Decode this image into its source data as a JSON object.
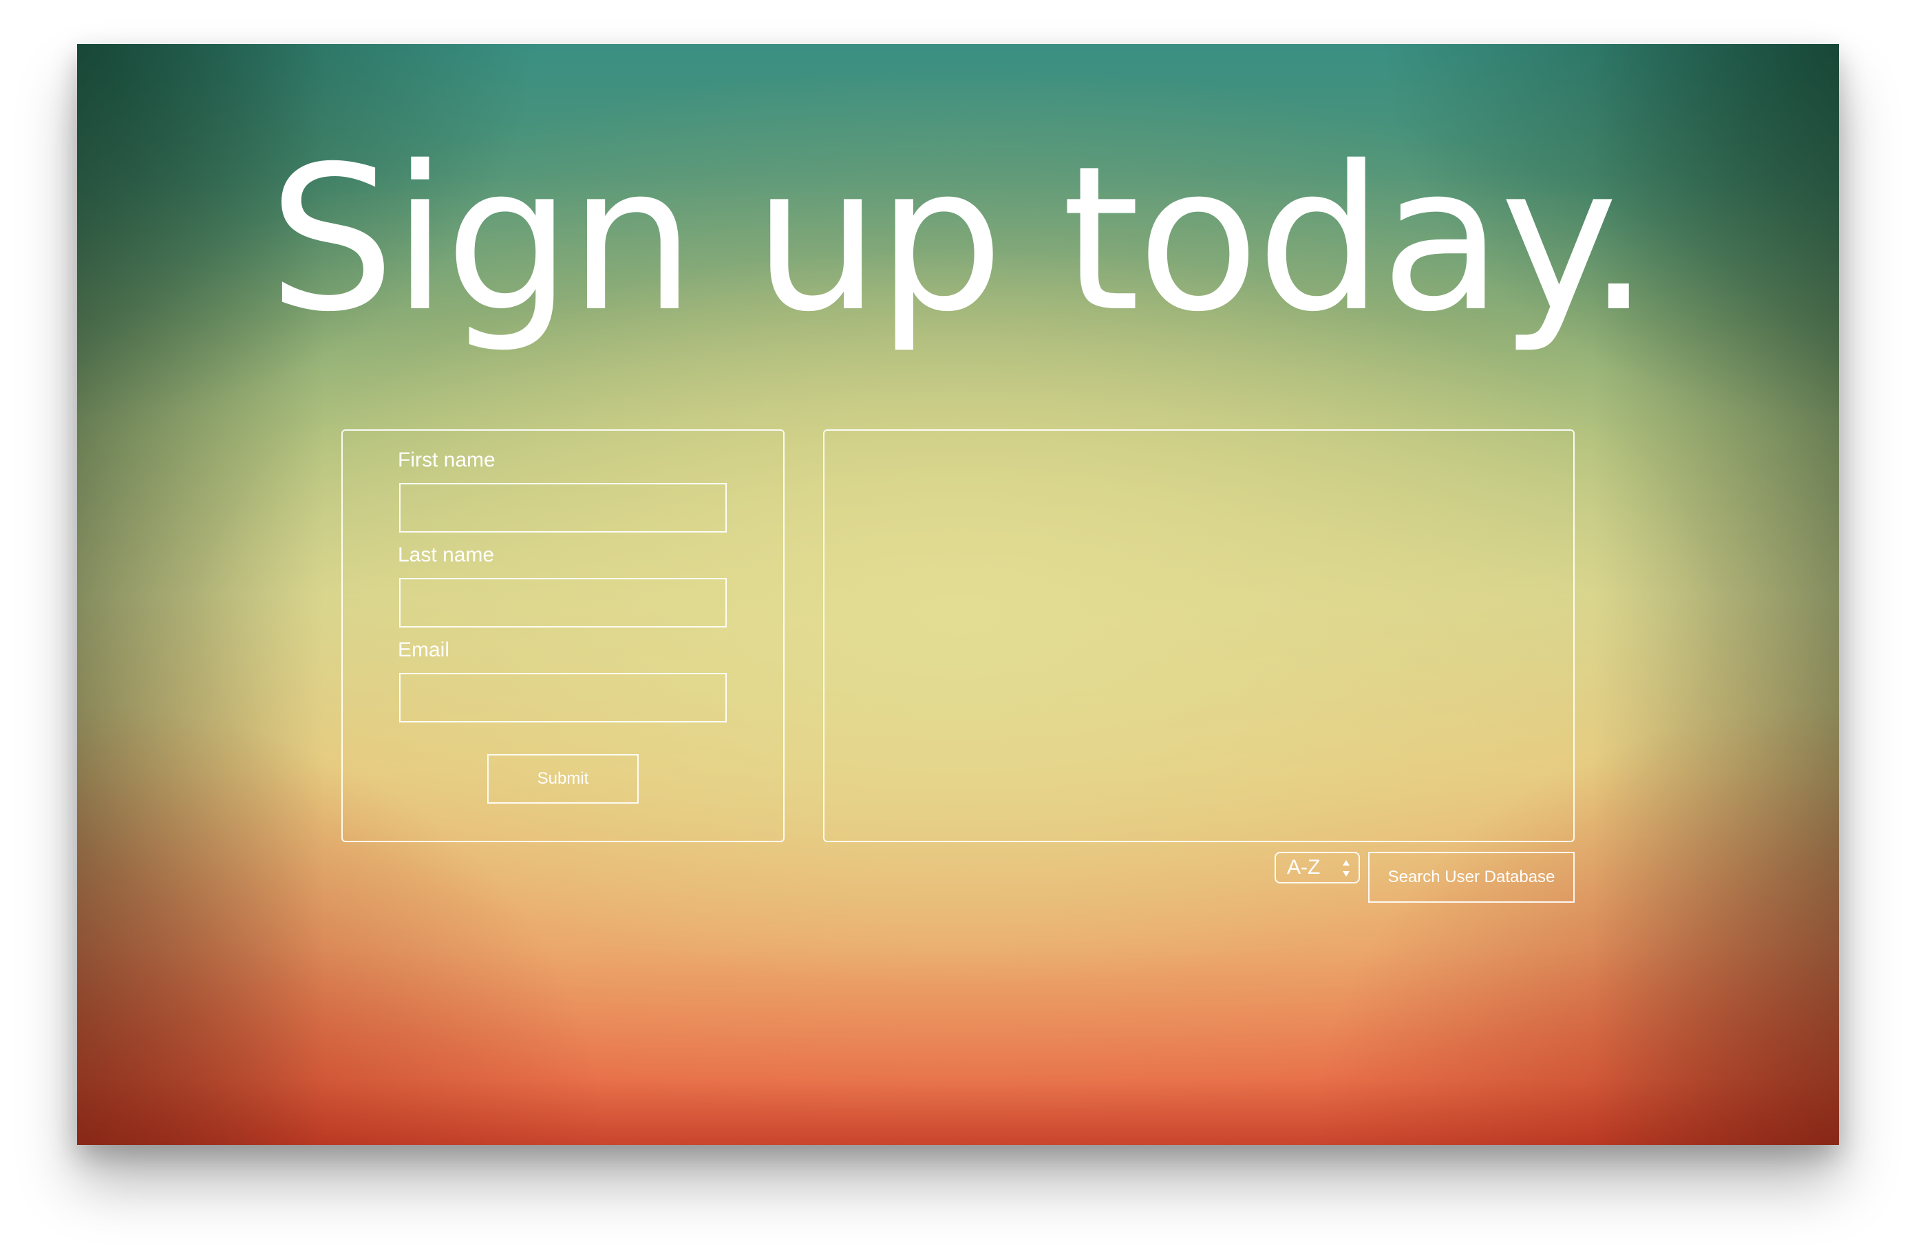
{
  "hero": {
    "title": "Sign up today."
  },
  "signup_form": {
    "first_name_label": "First name",
    "first_name_value": "",
    "last_name_label": "Last name",
    "last_name_value": "",
    "email_label": "Email",
    "email_value": "",
    "submit_label": "Submit"
  },
  "results_panel": {
    "items": []
  },
  "controls": {
    "sort_selected": "A-Z",
    "search_label": "Search User Database"
  },
  "colors": {
    "text": "#ffffff",
    "border": "#ffffff",
    "background_top": "#3a8f82",
    "background_middle": "#d2d58f",
    "background_bottom": "#c9452d"
  },
  "icons": {
    "sort_arrows": "up-down-arrows-icon"
  }
}
